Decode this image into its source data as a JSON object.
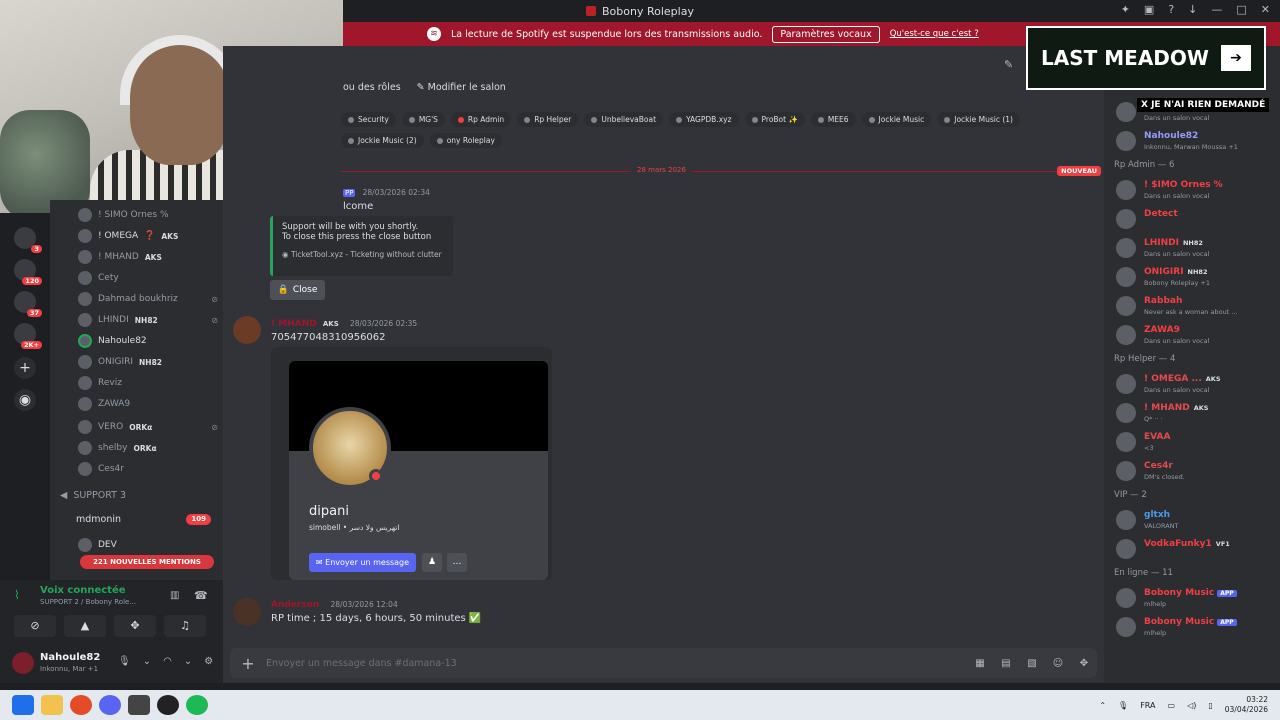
{
  "window": {
    "title": "Bobony Roleplay"
  },
  "banner": {
    "message": "La lecture de Spotify est suspendue lors des transmissions audio.",
    "button": "Paramètres vocaux",
    "link": "Qu'est-ce que c'est ?"
  },
  "toolbar": {
    "roles_label": "ou des rôles",
    "edit_label": "Modifier le salon"
  },
  "roles": [
    "Security",
    "MG'S",
    "Rp Admin",
    "Rp Helper",
    "UnbelievaBoat",
    "YAGPDB.xyz",
    "ProBot ✨",
    "MEE6",
    "Jockie Music",
    "Jockie Music (1)",
    "Jockie Music (2)",
    "ony Roleplay"
  ],
  "divider": {
    "date": "28 mars 2026",
    "new_label": "NOUVEAU"
  },
  "messages": {
    "first": {
      "badge": "PP",
      "timestamp": "28/03/2026 02:34",
      "text": "lcome"
    },
    "embed": {
      "line1": "Support will be with you shortly.",
      "line2": "To close this press the close button",
      "footer": "TicketTool.xyz - Ticketing without clutter"
    },
    "close_button": "Close",
    "second": {
      "author": "! MHAND",
      "tag": "AKS",
      "timestamp": "28/03/2026 02:35",
      "text": "705477048310956062"
    },
    "profile": {
      "name": "dipani",
      "sub": "simobell • اتهريس ولا دسر",
      "button": "Envoyer un message"
    },
    "third": {
      "author": "Anderson",
      "timestamp": "28/03/2026 12:04",
      "text": "RP time ; 15 days, 6 hours, 50 minutes ✅"
    }
  },
  "input": {
    "placeholder": "Envoyer un message dans #damana-13"
  },
  "channel_members": [
    {
      "name": "! OMEGA",
      "tag": "AKS",
      "icon": "❓"
    },
    {
      "name": "! MHAND",
      "tag": "AKS"
    },
    {
      "name": "Cety"
    },
    {
      "name": "Dahmad boukhriz"
    },
    {
      "name": "LHINDI",
      "tag": "NH82"
    },
    {
      "name": "Nahoule82"
    },
    {
      "name": "ONIGIRI",
      "tag": "NH82"
    },
    {
      "name": "Reviz"
    },
    {
      "name": "ZAWA9"
    },
    {
      "name": "VERO",
      "tag": "ORKα"
    },
    {
      "name": "shelby",
      "tag": "ORKα"
    },
    {
      "name": "Ces4r"
    }
  ],
  "channels": {
    "top_hidden": "! SIMO Ornes %",
    "support": "SUPPORT 3",
    "mdmonin": "mdmonin",
    "mdmonin_count": "109",
    "dev": "DEV",
    "mentions": "221 NOUVELLES MENTIONS"
  },
  "server_badges": [
    "3",
    "120",
    "37",
    "2K+"
  ],
  "voice": {
    "status": "Voix connectée",
    "channel": "SUPPORT 2 / Bobony Role..."
  },
  "me": {
    "name": "Nahoule82",
    "status": "Inkonnu, Mar +1"
  },
  "members": {
    "groups": [
      {
        "label": "Rp Admin — 6"
      },
      {
        "label": "Rp Helper — 4"
      },
      {
        "label": "VIP — 2"
      },
      {
        "label": "En ligne — 11"
      }
    ],
    "top": [
      {
        "name": "Cety",
        "status": "Dans un salon vocal",
        "color": "#6a7bff"
      },
      {
        "name": "Nahoule82",
        "status": "Inkonnu, Marwan Moussa +1",
        "color": "#949cf7"
      }
    ],
    "admins": [
      {
        "name": "! $IMO Ornes %",
        "status": "Dans un salon vocal",
        "color": "#f23f43"
      },
      {
        "name": "Detect",
        "status": "",
        "color": "#f23f43"
      },
      {
        "name": "LHINDI",
        "status": "Dans un salon vocal",
        "color": "#f23f43",
        "tag": "NH82"
      },
      {
        "name": "ONIGIRI",
        "status": "Bobony Roleplay +1",
        "color": "#f23f43",
        "tag": "NH82"
      },
      {
        "name": "Rabbah",
        "status": "Never ask a woman about ...",
        "color": "#f23f43"
      },
      {
        "name": "ZAWA9",
        "status": "Dans un salon vocal",
        "color": "#f23f43"
      }
    ],
    "helpers": [
      {
        "name": "! OMEGA ...",
        "status": "Dans un salon vocal",
        "color": "#e64a4a",
        "tag": "AKS"
      },
      {
        "name": "! MHAND",
        "status": "Q* ·· ·",
        "color": "#e64a4a",
        "tag": "AKS"
      },
      {
        "name": "EVAA",
        "status": "<3",
        "color": "#e64a4a"
      },
      {
        "name": "Ces4r",
        "status": "DM's closed.",
        "color": "#e64a4a"
      }
    ],
    "vip": [
      {
        "name": "gltxh",
        "status": "VALORANT",
        "color": "#4a9bf0"
      },
      {
        "name": "VodkaFunky1",
        "status": "",
        "color": "#f23f43",
        "tag": "VF1"
      }
    ],
    "online": [
      {
        "name": "Bobony Music",
        "status": "mlhelp",
        "color": "#f23f43",
        "app": "APP"
      },
      {
        "name": "Bobony Music",
        "status": "mlhelp",
        "color": "#f23f43",
        "app": "APP"
      }
    ]
  },
  "overlay": {
    "logo": "LAST MEADOW",
    "caption": "X JE N'AI RIEN DEMANDÉ"
  },
  "taskbar": {
    "lang": "FRA",
    "time": "03:22",
    "date": "03/04/2026"
  }
}
